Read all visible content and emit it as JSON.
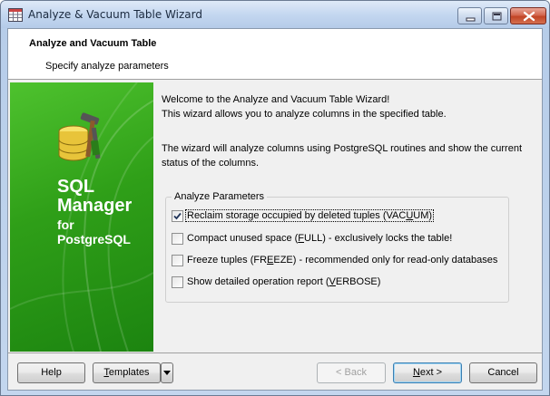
{
  "window": {
    "title": "Analyze & Vacuum Table Wizard"
  },
  "header": {
    "title": "Analyze and Vacuum Table",
    "subtitle": "Specify analyze parameters"
  },
  "banner": {
    "line1": "SQL",
    "line2": "Manager",
    "line3": "for",
    "line4": "PostgreSQL"
  },
  "content": {
    "welcome": "Welcome to the Analyze and Vacuum Table Wizard!",
    "description": "This wizard allows you to analyze columns in the specified table.",
    "info_line1": "The wizard will analyze columns using PostgreSQL routines and show the current",
    "info_line2": "status of the columns."
  },
  "parameters": {
    "group_label": "Analyze Parameters",
    "options": [
      {
        "pre": "Reclaim storage occupied by deleted tuples (VAC",
        "key": "U",
        "post": "UM)",
        "checked": true
      },
      {
        "pre": "Compact unused space (",
        "key": "F",
        "post": "ULL) - exclusively locks the table!",
        "checked": false
      },
      {
        "pre": "Freeze tuples (FR",
        "key": "E",
        "post": "EZE) - recommended only for read-only databases",
        "checked": false
      },
      {
        "pre": "Show detailed operation report (",
        "key": "V",
        "post": "ERBOSE)",
        "checked": false
      }
    ]
  },
  "footer": {
    "help": "Help",
    "templates_key": "T",
    "templates_rest": "emplates",
    "back": "< Back",
    "next_key": "N",
    "next_rest": "ext >",
    "cancel": "Cancel"
  },
  "colors": {
    "banner_green": "#2f9f18",
    "titlebar": "#c4d7f0",
    "close_button": "#c14426"
  },
  "icons": {
    "app": "table-wizard-icon",
    "banner": "database-tools-icon",
    "dropdown": "triangle-down-icon"
  }
}
